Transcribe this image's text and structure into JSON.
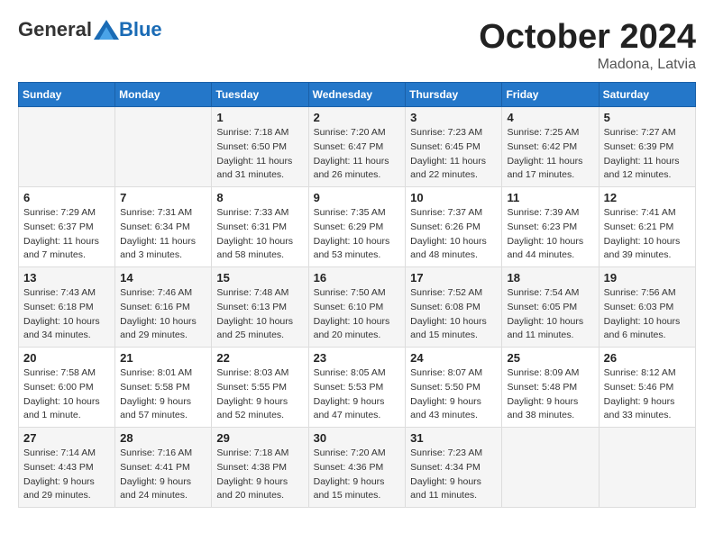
{
  "header": {
    "logo_general": "General",
    "logo_blue": "Blue",
    "month": "October 2024",
    "location": "Madona, Latvia"
  },
  "weekdays": [
    "Sunday",
    "Monday",
    "Tuesday",
    "Wednesday",
    "Thursday",
    "Friday",
    "Saturday"
  ],
  "weeks": [
    [
      null,
      null,
      {
        "day": 1,
        "sunrise": "7:18 AM",
        "sunset": "6:50 PM",
        "daylight": "11 hours and 31 minutes."
      },
      {
        "day": 2,
        "sunrise": "7:20 AM",
        "sunset": "6:47 PM",
        "daylight": "11 hours and 26 minutes."
      },
      {
        "day": 3,
        "sunrise": "7:23 AM",
        "sunset": "6:45 PM",
        "daylight": "11 hours and 22 minutes."
      },
      {
        "day": 4,
        "sunrise": "7:25 AM",
        "sunset": "6:42 PM",
        "daylight": "11 hours and 17 minutes."
      },
      {
        "day": 5,
        "sunrise": "7:27 AM",
        "sunset": "6:39 PM",
        "daylight": "11 hours and 12 minutes."
      }
    ],
    [
      {
        "day": 6,
        "sunrise": "7:29 AM",
        "sunset": "6:37 PM",
        "daylight": "11 hours and 7 minutes."
      },
      {
        "day": 7,
        "sunrise": "7:31 AM",
        "sunset": "6:34 PM",
        "daylight": "11 hours and 3 minutes."
      },
      {
        "day": 8,
        "sunrise": "7:33 AM",
        "sunset": "6:31 PM",
        "daylight": "10 hours and 58 minutes."
      },
      {
        "day": 9,
        "sunrise": "7:35 AM",
        "sunset": "6:29 PM",
        "daylight": "10 hours and 53 minutes."
      },
      {
        "day": 10,
        "sunrise": "7:37 AM",
        "sunset": "6:26 PM",
        "daylight": "10 hours and 48 minutes."
      },
      {
        "day": 11,
        "sunrise": "7:39 AM",
        "sunset": "6:23 PM",
        "daylight": "10 hours and 44 minutes."
      },
      {
        "day": 12,
        "sunrise": "7:41 AM",
        "sunset": "6:21 PM",
        "daylight": "10 hours and 39 minutes."
      }
    ],
    [
      {
        "day": 13,
        "sunrise": "7:43 AM",
        "sunset": "6:18 PM",
        "daylight": "10 hours and 34 minutes."
      },
      {
        "day": 14,
        "sunrise": "7:46 AM",
        "sunset": "6:16 PM",
        "daylight": "10 hours and 29 minutes."
      },
      {
        "day": 15,
        "sunrise": "7:48 AM",
        "sunset": "6:13 PM",
        "daylight": "10 hours and 25 minutes."
      },
      {
        "day": 16,
        "sunrise": "7:50 AM",
        "sunset": "6:10 PM",
        "daylight": "10 hours and 20 minutes."
      },
      {
        "day": 17,
        "sunrise": "7:52 AM",
        "sunset": "6:08 PM",
        "daylight": "10 hours and 15 minutes."
      },
      {
        "day": 18,
        "sunrise": "7:54 AM",
        "sunset": "6:05 PM",
        "daylight": "10 hours and 11 minutes."
      },
      {
        "day": 19,
        "sunrise": "7:56 AM",
        "sunset": "6:03 PM",
        "daylight": "10 hours and 6 minutes."
      }
    ],
    [
      {
        "day": 20,
        "sunrise": "7:58 AM",
        "sunset": "6:00 PM",
        "daylight": "10 hours and 1 minute."
      },
      {
        "day": 21,
        "sunrise": "8:01 AM",
        "sunset": "5:58 PM",
        "daylight": "9 hours and 57 minutes."
      },
      {
        "day": 22,
        "sunrise": "8:03 AM",
        "sunset": "5:55 PM",
        "daylight": "9 hours and 52 minutes."
      },
      {
        "day": 23,
        "sunrise": "8:05 AM",
        "sunset": "5:53 PM",
        "daylight": "9 hours and 47 minutes."
      },
      {
        "day": 24,
        "sunrise": "8:07 AM",
        "sunset": "5:50 PM",
        "daylight": "9 hours and 43 minutes."
      },
      {
        "day": 25,
        "sunrise": "8:09 AM",
        "sunset": "5:48 PM",
        "daylight": "9 hours and 38 minutes."
      },
      {
        "day": 26,
        "sunrise": "8:12 AM",
        "sunset": "5:46 PM",
        "daylight": "9 hours and 33 minutes."
      }
    ],
    [
      {
        "day": 27,
        "sunrise": "7:14 AM",
        "sunset": "4:43 PM",
        "daylight": "9 hours and 29 minutes."
      },
      {
        "day": 28,
        "sunrise": "7:16 AM",
        "sunset": "4:41 PM",
        "daylight": "9 hours and 24 minutes."
      },
      {
        "day": 29,
        "sunrise": "7:18 AM",
        "sunset": "4:38 PM",
        "daylight": "9 hours and 20 minutes."
      },
      {
        "day": 30,
        "sunrise": "7:20 AM",
        "sunset": "4:36 PM",
        "daylight": "9 hours and 15 minutes."
      },
      {
        "day": 31,
        "sunrise": "7:23 AM",
        "sunset": "4:34 PM",
        "daylight": "9 hours and 11 minutes."
      },
      null,
      null
    ]
  ]
}
